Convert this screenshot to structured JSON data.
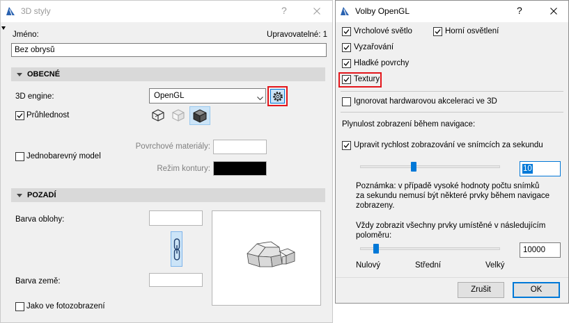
{
  "colors": {
    "accent": "#0078d7",
    "highlight": "#e3151a",
    "selected_bg": "#cce4f7",
    "dialog_bg": "#f0f0f0",
    "section_bg": "#d9d9d9"
  },
  "icons": {
    "app": "archicad-logo-icon",
    "gear": "gear-icon",
    "link": "chain-link-icon",
    "close": "close-icon",
    "dropdown": "chevron-down-icon",
    "section": "collapse-triangle-icon"
  },
  "left_dialog": {
    "title": "3D styly",
    "help_label": "?",
    "name_label": "Jméno:",
    "editable_label": "Upravovatelné: 1",
    "name_value": "Bez obrysů",
    "general": {
      "header": "OBECNÉ",
      "engine_label": "3D engine:",
      "engine_value": "OpenGL",
      "transparency": {
        "label": "Průhlednost",
        "checked": true
      },
      "render_modes": [
        {
          "icon": "wireframe-mode-icon",
          "selected": false,
          "dimmed": false
        },
        {
          "icon": "hidden-line-mode-icon",
          "selected": false,
          "dimmed": true
        },
        {
          "icon": "shaded-mode-icon",
          "selected": true,
          "dimmed": false
        }
      ],
      "monochrome": {
        "label": "Jednobarevný model",
        "checked": false
      },
      "surface_label": "Povrchové materiály:",
      "surface_color": "#ffffff",
      "contour_label": "Režim kontury:",
      "contour_color": "#000000"
    },
    "background": {
      "header": "POZADÍ",
      "sky_label": "Barva oblohy:",
      "sky_color": "#ffffff",
      "ground_label": "Barva země:",
      "ground_color": "#ffffff",
      "photo_render": {
        "label": "Jako ve fotozobrazení",
        "checked": false
      }
    }
  },
  "right_dialog": {
    "title": "Volby OpenGL",
    "help_label": "?",
    "options": {
      "vertex_light": {
        "label": "Vrcholové světlo",
        "checked": true
      },
      "top_light": {
        "label": "Horní osvětlení",
        "checked": true
      },
      "emission": {
        "label": "Vyzařování",
        "checked": true
      },
      "smooth_surfaces": {
        "label": "Hladké povrchy",
        "checked": true
      },
      "textures": {
        "label": "Textury",
        "checked": true
      }
    },
    "ignore_hw": {
      "label": "Ignorovat hardwarovou akceleraci ve 3D",
      "checked": false
    },
    "navigation_label": "Plynulost zobrazení během navigace:",
    "adjust_fps": {
      "label": "Upravit rychlost zobrazování ve snímcích za sekundu",
      "checked": true
    },
    "fps_slider_level": 0.38,
    "fps_value": "10",
    "note_lines": [
      "Poznámka: v případě vysoké hodnoty počtu snímků",
      "za sekundu nemusí být některé prvky během navigace",
      "zobrazeny."
    ],
    "radius_lines": [
      "Vždy zobrazit všechny prvky umístěné v následujícím",
      "poloměru:"
    ],
    "radius_slider_level": 0.11,
    "radius_value": "10000",
    "scale_labels": {
      "min": "Nulový",
      "mid": "Střední",
      "max": "Velký"
    },
    "cancel_label": "Zrušit",
    "ok_label": "OK"
  }
}
